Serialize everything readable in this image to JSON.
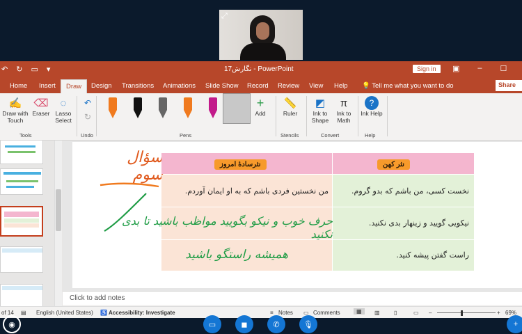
{
  "window": {
    "title": "نگارش17  -  PowerPoint",
    "sign_in": "Sign in",
    "share": "Share"
  },
  "tabs": [
    "Home",
    "Insert",
    "Draw",
    "Design",
    "Transitions",
    "Animations",
    "Slide Show",
    "Record",
    "Review",
    "View",
    "Help"
  ],
  "active_tab": "Draw",
  "tell_me": "Tell me what you want to do",
  "ribbon": {
    "tools": {
      "draw_touch": "Draw with Touch",
      "eraser": "Eraser",
      "lasso": "Lasso Select",
      "label": "Tools"
    },
    "undo": {
      "label": "Undo"
    },
    "pens": {
      "label": "Pens",
      "add": "Add",
      "colors": [
        "#f07a1e",
        "#111111",
        "#666666",
        "#f07a1e",
        "#c21a8a",
        "#f07a1e"
      ]
    },
    "stencils": {
      "ruler": "Ruler",
      "label": "Stencils"
    },
    "convert": {
      "ink_to_shape": "Ink to Shape",
      "ink_to_math": "Ink to Math",
      "label": "Convert"
    },
    "help": {
      "ink_help": "Ink Help",
      "label": "Help"
    }
  },
  "slide": {
    "ink_title": "سؤال سوم",
    "header_right": "نثر کهن",
    "header_left": "نثرسادهٔ امروز",
    "rows": [
      {
        "old": "نخست کسی، من باشم که بدو گروم.",
        "new": "من نخستین فردی باشم که به او ایمان آوردم."
      },
      {
        "old": "نیکویی گویید و زینهار بدی نکنید.",
        "new": "حرف خوب و نیکو بگویید مواظب باشید تا بدی نکنید"
      },
      {
        "old": "راست گفتن پیشه کنید.",
        "new": "همیشه راستگو باشید"
      }
    ]
  },
  "notes_placeholder": "Click to add notes",
  "status": {
    "slide_counter": "of 14",
    "language": "English (United States)",
    "accessibility": "Accessibility: Investigate",
    "notes": "Notes",
    "comments": "Comments",
    "zoom": "69%"
  },
  "colors": {
    "accent": "#b7472a",
    "header_pink": "#f4b6cf",
    "green_row": "#e3f1d8",
    "peach_row": "#fbe4d6",
    "ink_green": "#1f9c45",
    "ink_orange": "#f07a1e"
  }
}
